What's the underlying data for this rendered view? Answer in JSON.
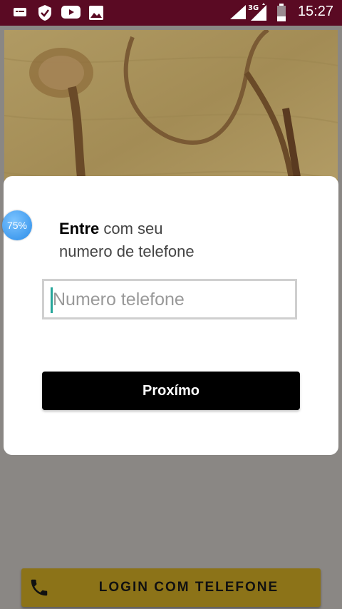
{
  "status_bar": {
    "time": "15:27",
    "network": "3G",
    "icons": [
      "message-icon",
      "shield-check-icon",
      "youtube-icon",
      "image-icon",
      "signal-icon",
      "mobile-data-icon",
      "battery-icon"
    ]
  },
  "background": {
    "hero": "stethoscope-image",
    "login_button": {
      "label": "LOGIN COM TELEFONE",
      "icon": "phone-icon"
    }
  },
  "dialog": {
    "heading_bold": "Entre",
    "heading_rest": "com seu",
    "heading_line2": "numero de telefone",
    "input_placeholder": "Numero telefone",
    "input_value": "",
    "next_label": "Proxímo"
  },
  "badge": {
    "label": "75%"
  },
  "colors": {
    "status_bar": "#5a0a23",
    "login_button": "#8c7318",
    "primary_button": "#000000",
    "caret": "#26a69a",
    "badge": "#2b8ce8"
  }
}
